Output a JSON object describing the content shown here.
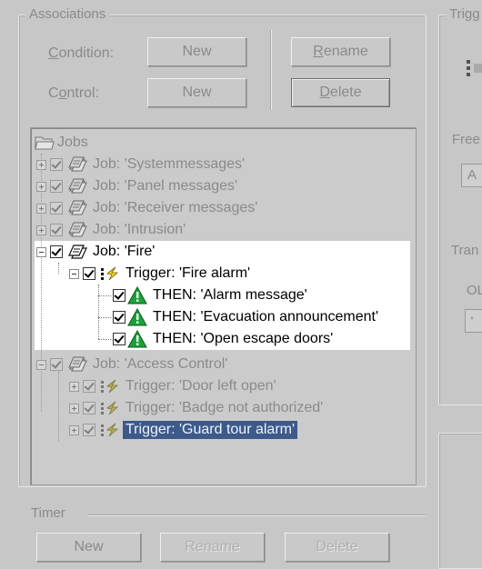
{
  "associations": {
    "legend": "Associations",
    "condition_label_u": "C",
    "condition_label_rest": "ondition:",
    "control_label_pre": "C",
    "control_label_u": "o",
    "control_label_rest": "ntrol:",
    "new_condition": "New",
    "new_control": "New",
    "rename_u": "R",
    "rename_rest": "ename",
    "delete_u": "D",
    "delete_rest": "elete"
  },
  "tree": {
    "root": "Jobs",
    "items": [
      {
        "text": "Job: 'Systemmessages'"
      },
      {
        "text": "Job: 'Panel messages'"
      },
      {
        "text": "Job: 'Receiver messages'"
      },
      {
        "text": "Job: 'Intrusion'"
      },
      {
        "text": "Job: 'Fire'"
      },
      {
        "text": "Trigger: 'Fire alarm'"
      },
      {
        "text": "THEN: 'Alarm message'"
      },
      {
        "text": "THEN: 'Evacuation announcement'"
      },
      {
        "text": "THEN: 'Open escape doors'"
      },
      {
        "text": "Job: 'Access Control'"
      },
      {
        "text": "Trigger: 'Door left open'"
      },
      {
        "text": "Trigger: 'Badge not authorized'"
      },
      {
        "text": "Trigger: 'Guard tour alarm'"
      }
    ]
  },
  "timer": {
    "legend": "Timer",
    "new": "New",
    "rename": "Rename",
    "delete": "Delete"
  },
  "right_panel": {
    "legend": "Trigg",
    "free": "Free",
    "input_value": "A",
    "tran": "Tran",
    "ol": "OL",
    "small": "*"
  },
  "colors": {
    "background": "#c7c7c7",
    "selection": "#3d5a8a",
    "warning_green": "#1aa23a"
  }
}
